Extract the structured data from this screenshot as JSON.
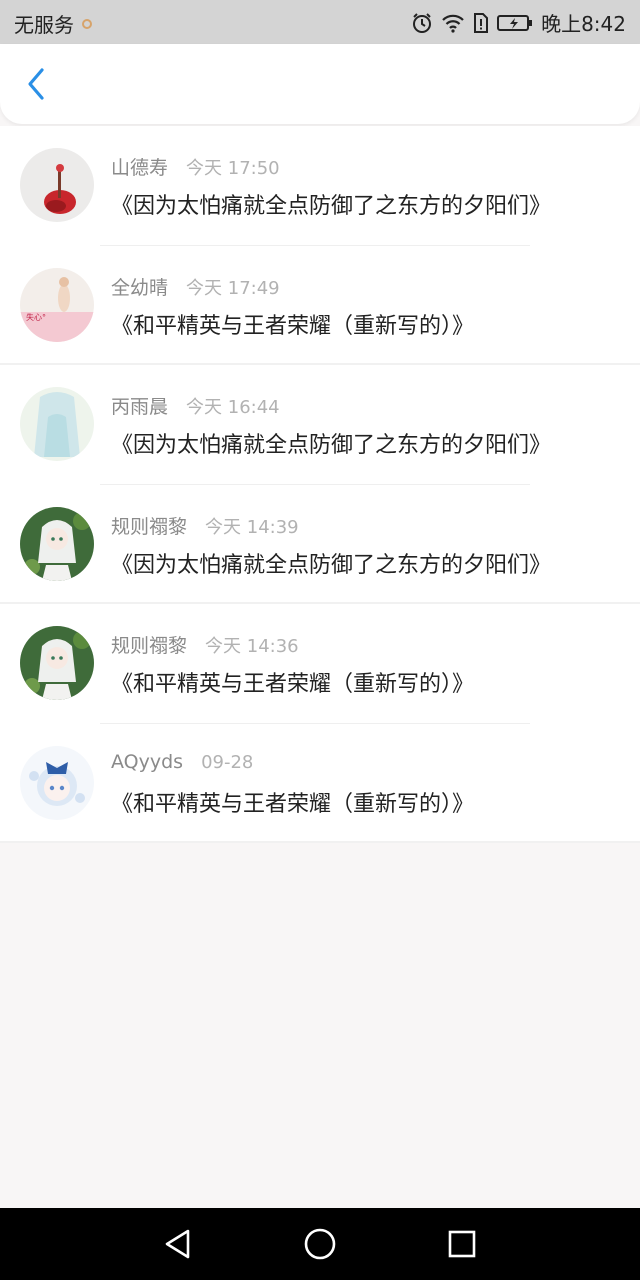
{
  "status_bar": {
    "carrier": "无服务",
    "time": "晚上8:42",
    "icons": [
      "alarm-icon",
      "wifi-icon",
      "sim-alert-icon",
      "battery-charging-icon"
    ]
  },
  "header": {
    "back_icon": "chevron-left-icon",
    "accent_color": "#2a8fe6"
  },
  "messages": [
    {
      "name": "山德寿",
      "time": "今天 17:50",
      "title": "《因为太怕痛就全点防御了之东方的夕阳们》"
    },
    {
      "name": "全幼晴",
      "time": "今天 17:49",
      "title": "《和平精英与王者荣耀（重新写的）》",
      "avatar_text": "失心°"
    },
    {
      "name": "丙雨晨",
      "time": "今天 16:44",
      "title": "《因为太怕痛就全点防御了之东方的夕阳们》"
    },
    {
      "name": "规则禤黎",
      "time": "今天 14:39",
      "title": "《因为太怕痛就全点防御了之东方的夕阳们》"
    },
    {
      "name": "规则禤黎",
      "time": "今天 14:36",
      "title": "《和平精英与王者荣耀（重新写的）》"
    },
    {
      "name": "AQyyds",
      "time": "09-28",
      "title": "《和平精英与王者荣耀（重新写的）》"
    }
  ],
  "nav_bar": {
    "buttons": [
      "back-triangle-icon",
      "home-circle-icon",
      "recents-square-icon"
    ]
  }
}
